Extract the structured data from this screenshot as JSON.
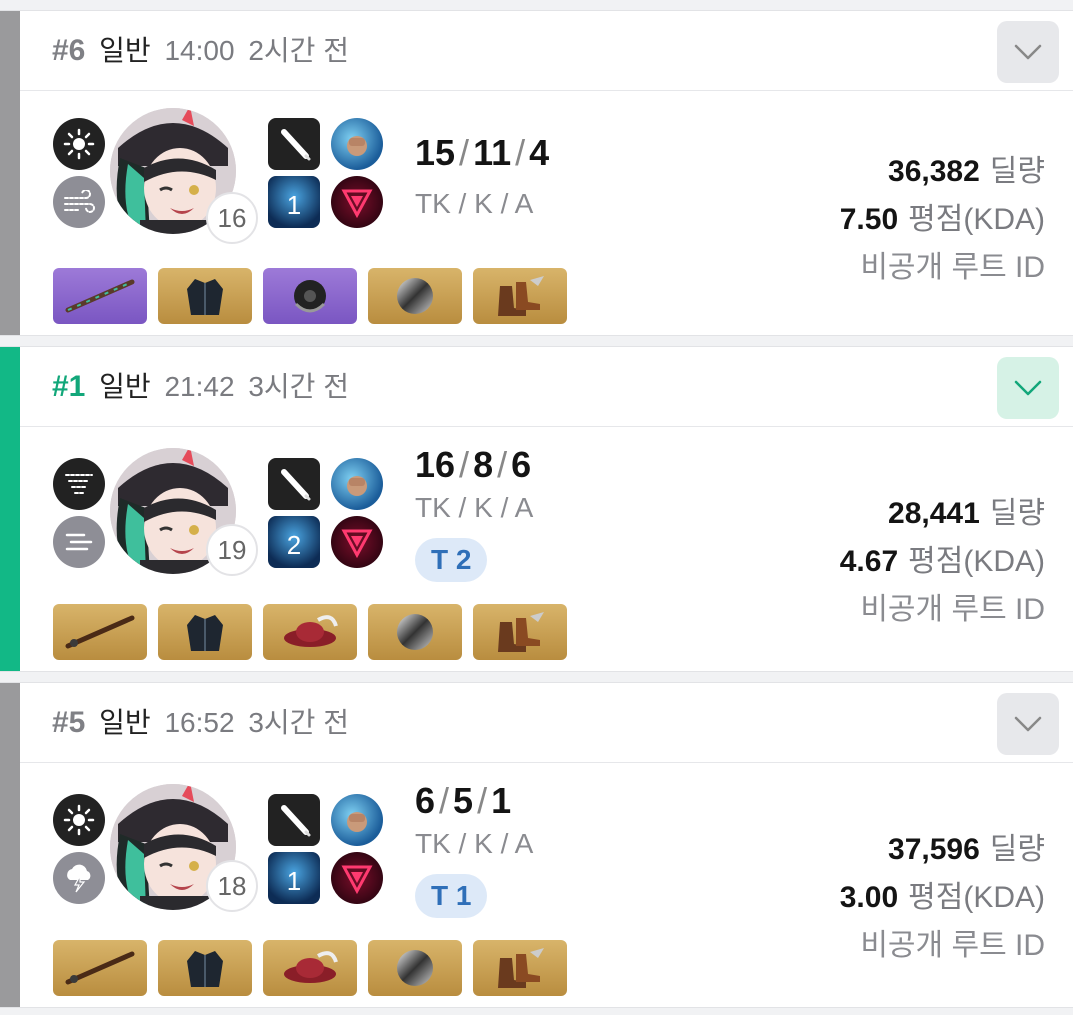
{
  "matches": [
    {
      "rank": "#6",
      "mode": "일반",
      "time": "14:00",
      "ago": "2시간 전",
      "level": "16",
      "weapon_level": "1",
      "kda": {
        "tk": "15",
        "k": "11",
        "a": "4",
        "label": "TK / K / A"
      },
      "team_badge": "",
      "damage": "36,382",
      "damage_label": "딜량",
      "score": "7.50",
      "score_label": "평점(KDA)",
      "route_id": "비공개 루트 ID",
      "traits": [
        "sun-icon",
        "wind-icon"
      ],
      "items": [
        "staff-item",
        "jacket-item",
        "helmet-item",
        "disc-item",
        "boots-item"
      ],
      "item_grades": [
        "purple",
        "gold",
        "purple",
        "gold",
        "gold"
      ],
      "accent": "#9a9a9c",
      "rank_color": "#7f8085",
      "expanded": false
    },
    {
      "rank": "#1",
      "mode": "일반",
      "time": "21:42",
      "ago": "3시간 전",
      "level": "19",
      "weapon_level": "2",
      "kda": {
        "tk": "16",
        "k": "8",
        "a": "6",
        "label": "TK / K / A"
      },
      "team_badge": "T 2",
      "damage": "28,441",
      "damage_label": "딜량",
      "score": "4.67",
      "score_label": "평점(KDA)",
      "route_id": "비공개 루트 ID",
      "traits": [
        "tornado-icon",
        "fog-icon"
      ],
      "items": [
        "staff-item",
        "jacket-item",
        "hat-item",
        "disc-item",
        "boots-item"
      ],
      "item_grades": [
        "gold",
        "gold",
        "gold",
        "gold",
        "gold"
      ],
      "accent": "#12b886",
      "rank_color": "#12a77a",
      "expanded": true
    },
    {
      "rank": "#5",
      "mode": "일반",
      "time": "16:52",
      "ago": "3시간 전",
      "level": "18",
      "weapon_level": "1",
      "kda": {
        "tk": "6",
        "k": "5",
        "a": "1",
        "label": "TK / K / A"
      },
      "team_badge": "T 1",
      "damage": "37,596",
      "damage_label": "딜량",
      "score": "3.00",
      "score_label": "평점(KDA)",
      "route_id": "비공개 루트 ID",
      "traits": [
        "sun-icon",
        "storm-icon"
      ],
      "items": [
        "staff-item",
        "jacket-item",
        "hat-item",
        "disc-item",
        "boots-item"
      ],
      "item_grades": [
        "gold",
        "gold",
        "gold",
        "gold",
        "gold"
      ],
      "accent": "#9a9a9c",
      "rank_color": "#7f8085",
      "expanded": false
    }
  ]
}
